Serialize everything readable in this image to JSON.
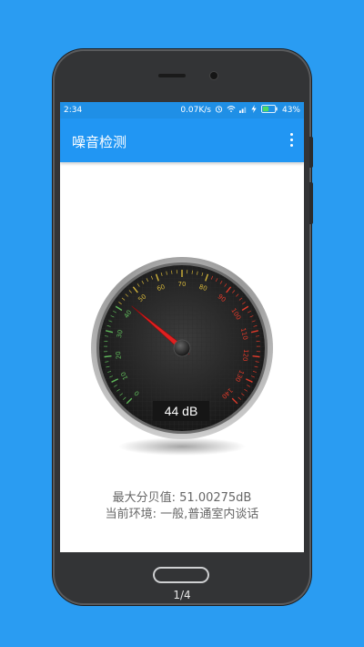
{
  "status_bar": {
    "time": "2:34",
    "network_speed": "0.07K/s",
    "battery": "43%",
    "icons": [
      "alarm-icon",
      "wifi-icon",
      "signal-icon",
      "charging-icon",
      "battery-icon"
    ]
  },
  "app_bar": {
    "title": "噪音检测",
    "menu_icon": "more-vert-icon"
  },
  "gauge": {
    "value": 44,
    "min": 0,
    "max": 140,
    "tick_labels": [
      "0",
      "10",
      "20",
      "30",
      "40",
      "50",
      "60",
      "70",
      "80",
      "90",
      "100",
      "110",
      "120",
      "130",
      "140"
    ],
    "readout": "44 dB"
  },
  "info": {
    "max_db": "最大分贝值: 51.00275dB",
    "environment": "当前环境: 一般,普通室内谈话"
  },
  "pager": {
    "indicator": "1/4"
  },
  "colors": {
    "accent": "#2196f3",
    "background": "#2a9cf2",
    "needle": "#e02020"
  }
}
